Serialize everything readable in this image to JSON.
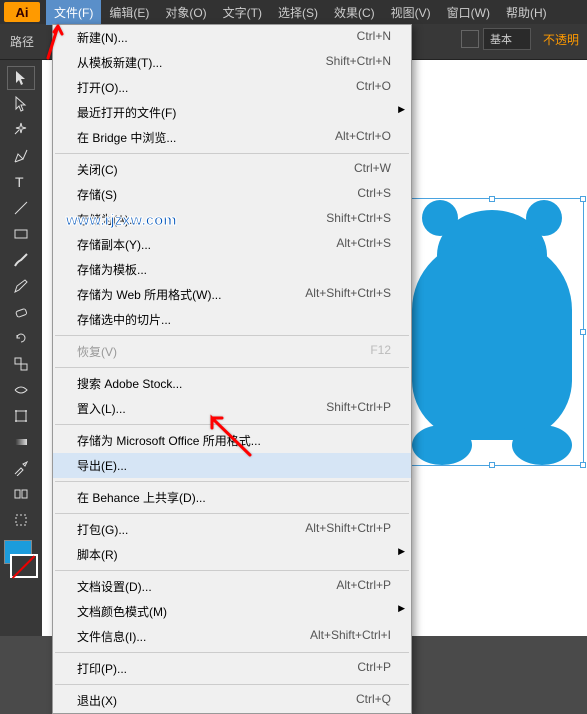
{
  "app": {
    "logo": "Ai"
  },
  "menubar": [
    {
      "label": "文件(F)",
      "active": true
    },
    {
      "label": "编辑(E)"
    },
    {
      "label": "对象(O)"
    },
    {
      "label": "文字(T)"
    },
    {
      "label": "选择(S)"
    },
    {
      "label": "效果(C)"
    },
    {
      "label": "视图(V)"
    },
    {
      "label": "窗口(W)"
    },
    {
      "label": "帮助(H)"
    }
  ],
  "subbar": {
    "label": "路径",
    "style_selected": "基本",
    "opacity_label": "不透明"
  },
  "file_menu": [
    {
      "type": "item",
      "label": "新建(N)...",
      "shortcut": "Ctrl+N"
    },
    {
      "type": "item",
      "label": "从模板新建(T)...",
      "shortcut": "Shift+Ctrl+N"
    },
    {
      "type": "item",
      "label": "打开(O)...",
      "shortcut": "Ctrl+O"
    },
    {
      "type": "item",
      "label": "最近打开的文件(F)",
      "submenu": true
    },
    {
      "type": "item",
      "label": "在 Bridge 中浏览...",
      "shortcut": "Alt+Ctrl+O"
    },
    {
      "type": "sep"
    },
    {
      "type": "item",
      "label": "关闭(C)",
      "shortcut": "Ctrl+W"
    },
    {
      "type": "item",
      "label": "存储(S)",
      "shortcut": "Ctrl+S"
    },
    {
      "type": "item",
      "label": "存储为(A)...",
      "shortcut": "Shift+Ctrl+S"
    },
    {
      "type": "item",
      "label": "存储副本(Y)...",
      "shortcut": "Alt+Ctrl+S"
    },
    {
      "type": "item",
      "label": "存储为模板..."
    },
    {
      "type": "item",
      "label": "存储为 Web 所用格式(W)...",
      "shortcut": "Alt+Shift+Ctrl+S"
    },
    {
      "type": "item",
      "label": "存储选中的切片..."
    },
    {
      "type": "sep_short"
    },
    {
      "type": "item",
      "label": "恢复(V)",
      "shortcut": "F12",
      "disabled": true
    },
    {
      "type": "sep"
    },
    {
      "type": "item",
      "label": "搜索 Adobe Stock..."
    },
    {
      "type": "item",
      "label": "置入(L)...",
      "shortcut": "Shift+Ctrl+P"
    },
    {
      "type": "sep"
    },
    {
      "type": "item",
      "label": "存储为 Microsoft Office 所用格式..."
    },
    {
      "type": "item",
      "label": "导出(E)...",
      "highlighted": true
    },
    {
      "type": "sep_short"
    },
    {
      "type": "item",
      "label": "在 Behance 上共享(D)..."
    },
    {
      "type": "sep"
    },
    {
      "type": "item",
      "label": "打包(G)...",
      "shortcut": "Alt+Shift+Ctrl+P"
    },
    {
      "type": "item",
      "label": "脚本(R)",
      "submenu": true
    },
    {
      "type": "sep"
    },
    {
      "type": "item",
      "label": "文档设置(D)...",
      "shortcut": "Alt+Ctrl+P"
    },
    {
      "type": "item",
      "label": "文档颜色模式(M)",
      "submenu": true
    },
    {
      "type": "item",
      "label": "文件信息(I)...",
      "shortcut": "Alt+Shift+Ctrl+I"
    },
    {
      "type": "sep"
    },
    {
      "type": "item",
      "label": "打印(P)...",
      "shortcut": "Ctrl+P"
    },
    {
      "type": "sep"
    },
    {
      "type": "item",
      "label": "退出(X)",
      "shortcut": "Ctrl+Q"
    }
  ],
  "watermark": "www.rjzxw.com",
  "colors": {
    "accent": "#1c9cdc",
    "ui_dark": "#383838",
    "arrow": "#ff0000"
  }
}
